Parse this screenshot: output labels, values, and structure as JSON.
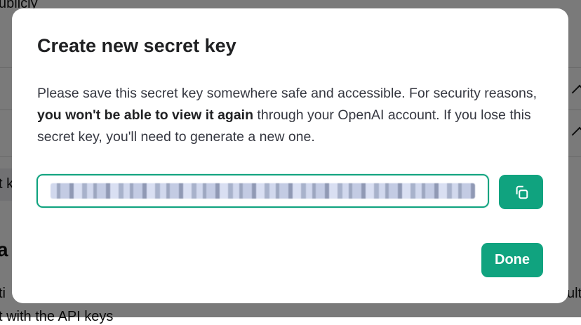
{
  "background": {
    "snippet_top": "ublicly",
    "snippet_left_mid": "t k",
    "snippet_left_lower": "a",
    "snippet_bottom_left": "ti",
    "snippet_bottom_right": "ult",
    "snippet_bottom_line": "t with the API keys"
  },
  "modal": {
    "title": "Create new secret key",
    "description_part1": "Please save this secret key somewhere safe and accessible. For security reasons, ",
    "description_bold": "you won't be able to view it again",
    "description_part2": " through your OpenAI account. If you lose this secret key, you'll need to generate a new one.",
    "secret_key_field": {
      "value": "",
      "masked": true
    },
    "copy_button": {
      "icon": "copy-icon"
    },
    "done_label": "Done"
  },
  "colors": {
    "accent": "#10a37f",
    "overlay": "rgba(0,0,0,0.52)"
  }
}
